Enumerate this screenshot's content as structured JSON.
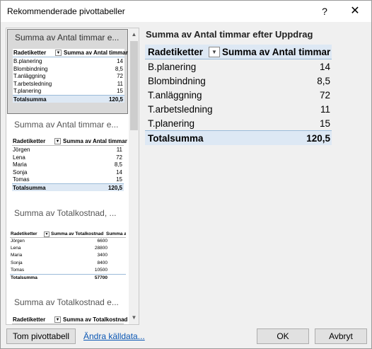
{
  "window": {
    "title": "Rekommenderade pivottabeller",
    "help_label": "?",
    "close_label": "✕"
  },
  "list": {
    "cards": [
      {
        "title": "Summa av Antal timmar e...",
        "header": [
          "Radetiketter",
          "Summa av Antal timmar"
        ],
        "rows": [
          [
            "B.planering",
            "14"
          ],
          [
            "Blombindning",
            "8,5"
          ],
          [
            "T.anläggning",
            "72"
          ],
          [
            "T.arbetsledning",
            "11"
          ],
          [
            "T.planering",
            "15"
          ]
        ],
        "total": [
          "Totalsumma",
          "120,5"
        ]
      },
      {
        "title": "Summa av Antal timmar e...",
        "header": [
          "Radetiketter",
          "Summa av Antal timmar"
        ],
        "rows": [
          [
            "Jörgen",
            "11"
          ],
          [
            "Lena",
            "72"
          ],
          [
            "Maria",
            "8,5"
          ],
          [
            "Sonja",
            "14"
          ],
          [
            "Tomas",
            "15"
          ]
        ],
        "total": [
          "Totalsumma",
          "120,5"
        ]
      },
      {
        "title": "Summa av Totalkostnad, ...",
        "header": [
          "Radetiketter",
          "Summa av Totalkostnad",
          "Summa av"
        ],
        "rows": [
          [
            "Jörgen",
            "6600"
          ],
          [
            "Lena",
            "28800"
          ],
          [
            "Maria",
            "3400"
          ],
          [
            "Sonja",
            "8400"
          ],
          [
            "Tomas",
            "10500"
          ]
        ],
        "total": [
          "Totalsumma",
          "57700"
        ]
      },
      {
        "title": "Summa av Totalkostnad e...",
        "header": [
          "Radetiketter",
          "Summa av Totalkostnad"
        ]
      }
    ]
  },
  "preview": {
    "title": "Summa av Antal timmar efter Uppdrag",
    "header": [
      "Radetiketter",
      "Summa av Antal timmar"
    ],
    "rows": [
      [
        "B.planering",
        "14"
      ],
      [
        "Blombindning",
        "8,5"
      ],
      [
        "T.anläggning",
        "72"
      ],
      [
        "T.arbetsledning",
        "11"
      ],
      [
        "T.planering",
        "15"
      ]
    ],
    "total": [
      "Totalsumma",
      "120,5"
    ]
  },
  "footer": {
    "empty_pivot_label": "Tom pivottabell",
    "change_source_label": "Ändra källdata...",
    "ok_label": "OK",
    "cancel_label": "Avbryt"
  },
  "colors": {
    "header_fill": "#dde8f4",
    "border": "#9bbbd9",
    "link": "#0a56b3",
    "selected_card": "#d9d9d9"
  },
  "icons": {
    "dropdown": "chevron-down-icon",
    "close": "close-icon",
    "help": "help-icon"
  }
}
